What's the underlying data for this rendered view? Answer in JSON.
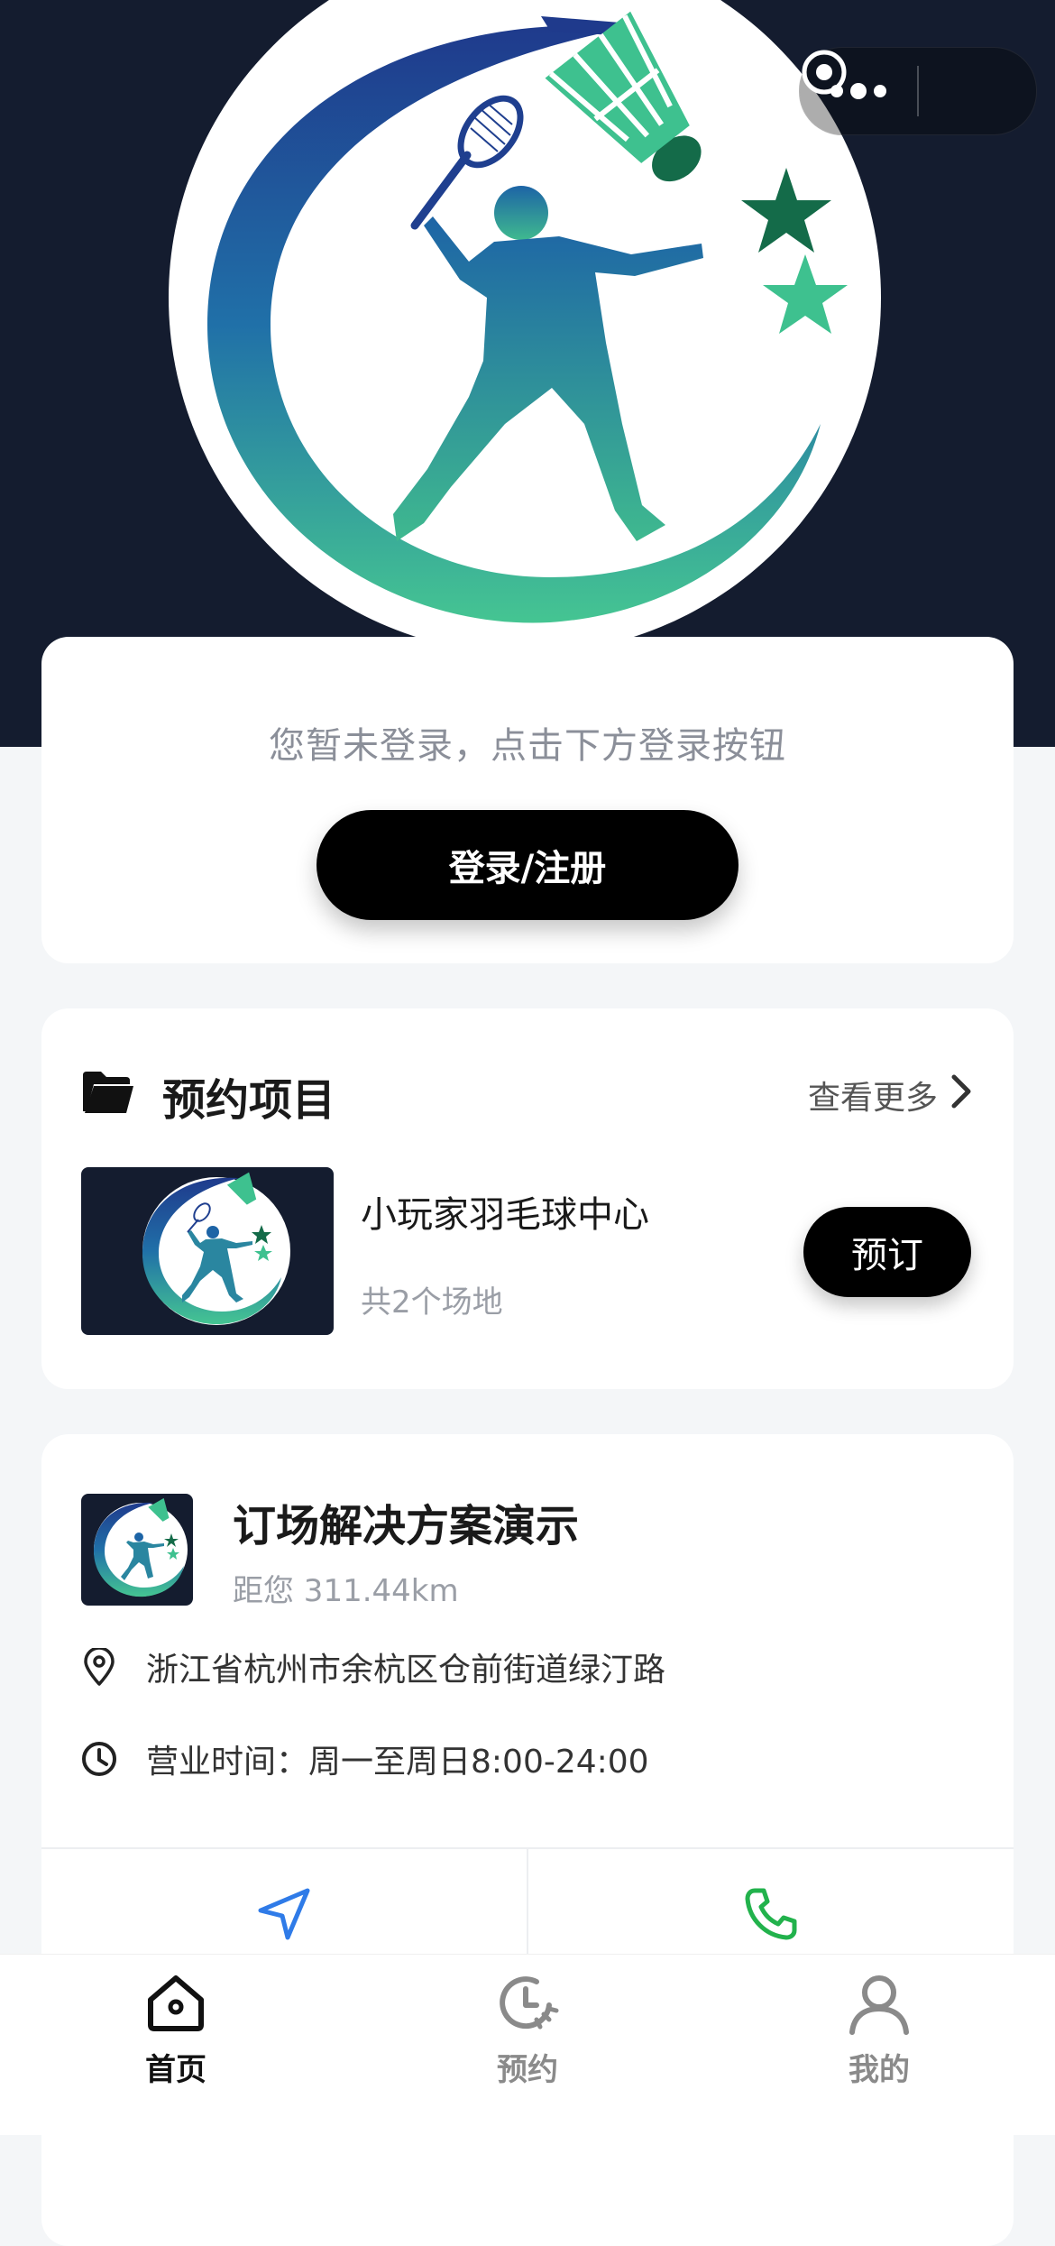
{
  "capsule": {
    "more_icon": "more-dots-icon",
    "close_icon": "target-icon"
  },
  "login": {
    "tip": "您暂未登录，点击下方登录按钮",
    "button_label": "登录/注册"
  },
  "projects": {
    "title": "预约项目",
    "see_more": "查看更多",
    "items": [
      {
        "name": "小玩家羽毛球中心",
        "courts": "共2个场地",
        "book_label": "预订"
      }
    ]
  },
  "venue": {
    "name": "订场解决方案演示",
    "distance": "距您 311.44km",
    "address": "浙江省杭州市余杭区仓前街道绿汀路",
    "hours": "营业时间：周一至周日8:00-24:00"
  },
  "tabs": [
    {
      "label": "首页",
      "icon": "home-icon",
      "active": true
    },
    {
      "label": "预约",
      "icon": "clock-icon",
      "active": false
    },
    {
      "label": "我的",
      "icon": "user-icon",
      "active": false
    }
  ],
  "colors": {
    "hero_bg": "#141c2f",
    "brand_blue": "#1f3f8f",
    "brand_green": "#3ec18f",
    "nav_blue": "#2f7be8",
    "phone_green": "#22b24c"
  }
}
